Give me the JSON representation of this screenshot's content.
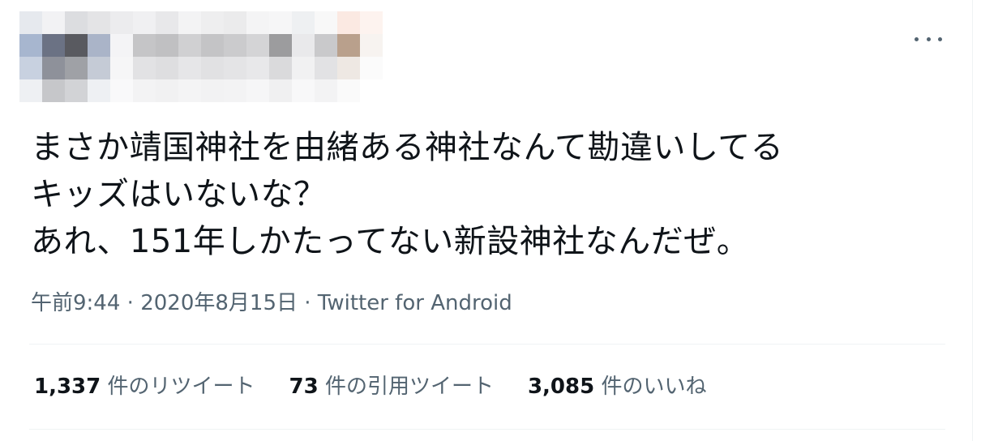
{
  "tweet": {
    "text_lines": [
      "まさか靖国神社を由緒ある神社なんて勘違いしてる",
      "キッズはいないな？",
      "あれ、151年しかたってない新設神社なんだぜ。"
    ],
    "time": "午前9:44",
    "separator": " · ",
    "date": "2020年8月15日",
    "source": "Twitter for Android"
  },
  "stats": {
    "retweets": {
      "count": "1,337",
      "label": " 件のリツイート"
    },
    "quotes": {
      "count": "73",
      "label": " 件の引用ツイート"
    },
    "likes": {
      "count": "3,085",
      "label": " 件のいいね"
    }
  },
  "icons": {
    "more": "more-horizontal-icon"
  },
  "colors": {
    "text_primary": "#0f1419",
    "text_secondary": "#536471",
    "divider": "#eff3f4"
  }
}
